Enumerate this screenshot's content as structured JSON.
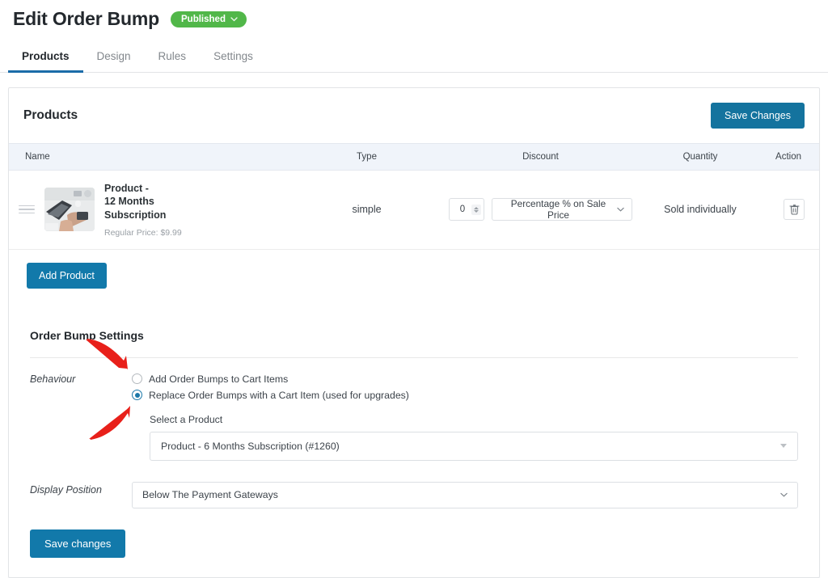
{
  "header": {
    "title": "Edit Order Bump",
    "status": {
      "label": "Published",
      "color": "#51b749"
    }
  },
  "tabs": [
    {
      "label": "Products",
      "active": true
    },
    {
      "label": "Design",
      "active": false
    },
    {
      "label": "Rules",
      "active": false
    },
    {
      "label": "Settings",
      "active": false
    }
  ],
  "products_card": {
    "title": "Products",
    "save_button": "Save Changes",
    "add_button": "Add Product",
    "columns": [
      "Name",
      "Type",
      "Discount",
      "Quantity",
      "Action"
    ],
    "rows": [
      {
        "name": "Product - 12 Months Subscription",
        "price_note": "Regular Price: $9.99",
        "type": "simple",
        "discount_value": "0",
        "discount_mode": "Percentage % on Sale Price",
        "quantity": "Sold individually",
        "action_icon": "trash-icon",
        "drag_icon": "drag-handle-icon",
        "thumbnail_alt": "laptop desk flat lay photo"
      }
    ]
  },
  "settings": {
    "title": "Order Bump Settings",
    "behaviour": {
      "label": "Behaviour",
      "options": [
        {
          "label": "Add Order Bumps to Cart Items",
          "selected": false
        },
        {
          "label": "Replace Order Bumps with a Cart Item (used for upgrades)",
          "selected": true
        }
      ],
      "select_product_label": "Select a Product",
      "selected_product": "Product - 6 Months Subscription (#1260)"
    },
    "display_position": {
      "label": "Display Position",
      "value": "Below The Payment Gateways"
    },
    "save_button": "Save changes"
  },
  "annotations": {
    "arrow_color": "#e8201a",
    "arrow_behaviour_target": "Replace Order Bumps with a Cart Item radio",
    "arrow_product_target": "Select a Product dropdown"
  }
}
